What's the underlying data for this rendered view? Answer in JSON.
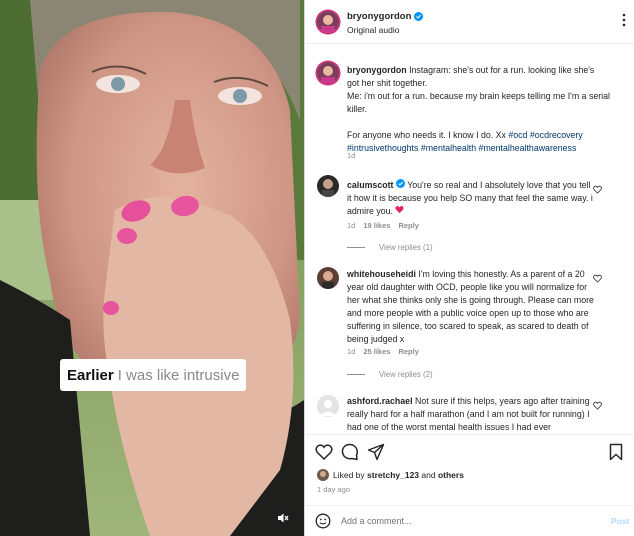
{
  "post": {
    "username": "bryonygordon",
    "audio": "Original audio",
    "caption_user": "bryonygordon",
    "caption_lines": [
      "Instagram: she's out for a run. looking like she's",
      "got her shit together.",
      "Me: i'm out for a run. because my brain keeps telling me I'm a serial",
      "killer."
    ],
    "caption_line2_a": "For anyone who needs it. I know I do. Xx",
    "caption_tags_1": "#ocd #ocdrecovery",
    "caption_tags_2": "#intrusivethoughts #mentalhealth #mentalhealthawareness",
    "caption_age": "1d"
  },
  "video": {
    "subtitle_bold": "Earlier",
    "subtitle_rest": "I was like intrusive",
    "mute_icon": "speaker-muted-icon"
  },
  "comments": [
    {
      "user": "calumscott",
      "verified": true,
      "lines": [
        "You're so real and I absolutely love that you tell",
        "it how it is because you help SO many that feel the same way. i",
        "admire you."
      ],
      "age": "1d",
      "likes": "19 likes",
      "reply": "Reply",
      "view_replies": "View replies (1)"
    },
    {
      "user": "whitehouseheidi",
      "lines": [
        "I'm loving this honestly. As a parent of a 20",
        "year old daughter with OCD, people like you will normalize for",
        "her what she thinks only she is going through. Please can more",
        "and more people with a public voice open up to those who are",
        "suffering in silence, too scared to speak, as scared to death of",
        "being judged x"
      ],
      "age": "1d",
      "likes": "25 likes",
      "reply": "Reply",
      "view_replies": "View replies (2)"
    },
    {
      "user": "ashford.rachael",
      "lines": [
        "Not sure if this helps, years ago after training",
        "really hard for a half marathon (and I am not built for running) I",
        "had one of the worst mental health issues I had ever"
      ]
    }
  ],
  "liked_by": {
    "prefix": "Liked by",
    "user": "stretchy_123",
    "mid": "and",
    "others": "others"
  },
  "time_ago": "1 day ago",
  "add_comment": {
    "placeholder": "Add a comment...",
    "post": "Post"
  },
  "colors": {
    "accent": "#0095f6",
    "heart": "#ed4956",
    "link": "#00376b",
    "muted": "#8e8e8e"
  }
}
